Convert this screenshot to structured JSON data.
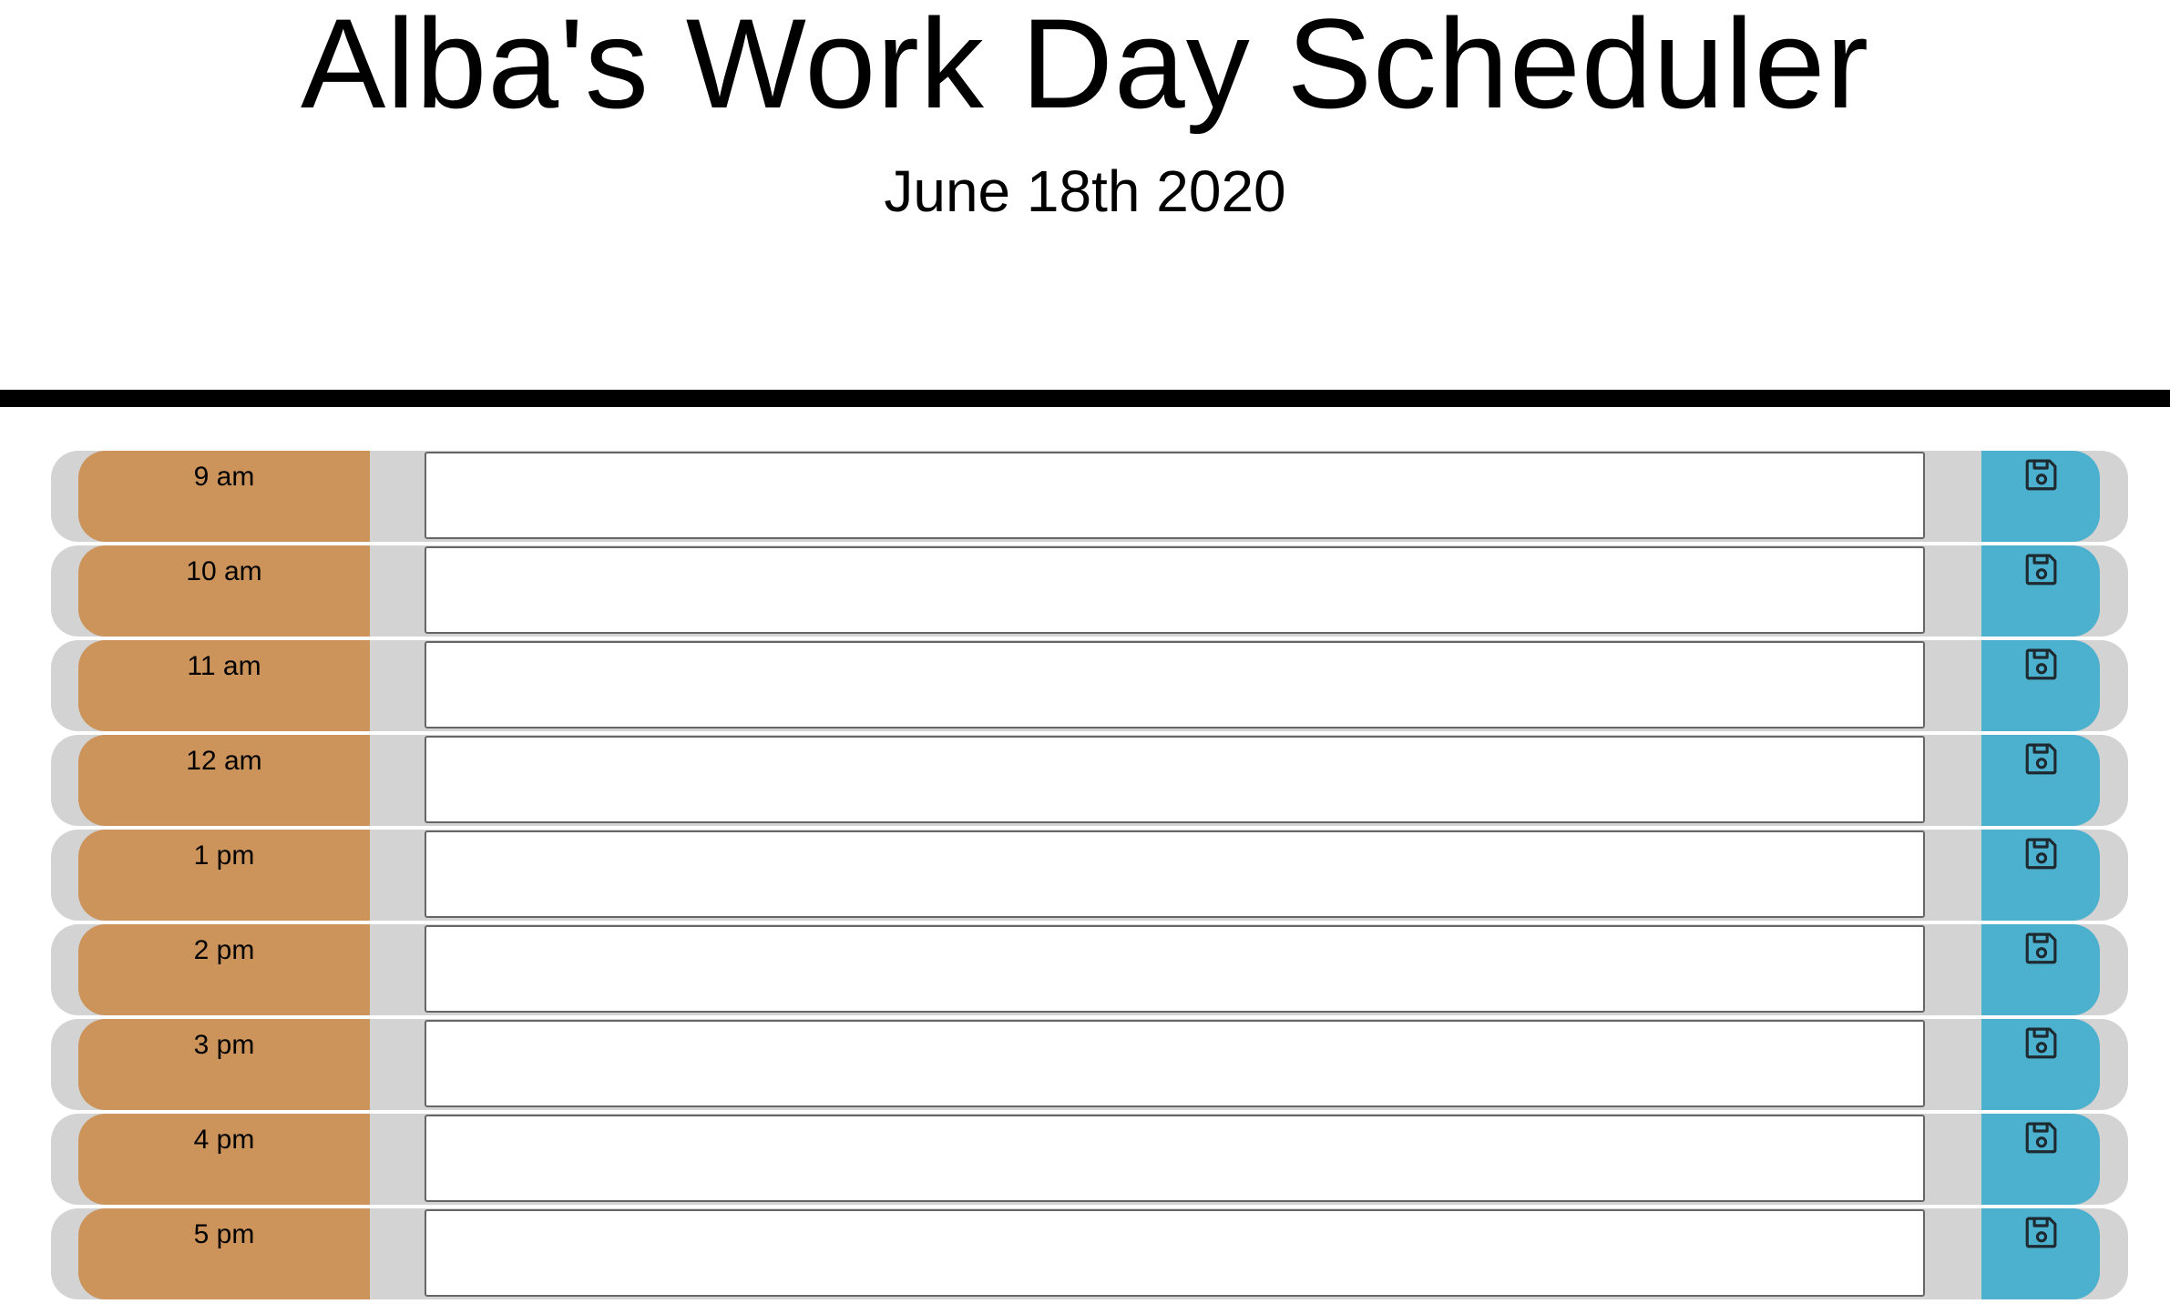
{
  "header": {
    "title": "Alba's Work Day Scheduler",
    "date": "June 18th 2020"
  },
  "colors": {
    "hour_block": "#cc935b",
    "row_background": "#d3d3d3",
    "save_button": "#4cb0cf",
    "divider": "#000000"
  },
  "schedule": {
    "rows": [
      {
        "hour": "9 am",
        "task": "",
        "save_icon": "floppy-disk-icon"
      },
      {
        "hour": "10 am",
        "task": "",
        "save_icon": "floppy-disk-icon"
      },
      {
        "hour": "11 am",
        "task": "",
        "save_icon": "floppy-disk-icon"
      },
      {
        "hour": "12 am",
        "task": "",
        "save_icon": "floppy-disk-icon"
      },
      {
        "hour": "1 pm",
        "task": "",
        "save_icon": "floppy-disk-icon"
      },
      {
        "hour": "2 pm",
        "task": "",
        "save_icon": "floppy-disk-icon"
      },
      {
        "hour": "3 pm",
        "task": "",
        "save_icon": "floppy-disk-icon"
      },
      {
        "hour": "4 pm",
        "task": "",
        "save_icon": "floppy-disk-icon"
      },
      {
        "hour": "5 pm",
        "task": "",
        "save_icon": "floppy-disk-icon"
      }
    ]
  }
}
